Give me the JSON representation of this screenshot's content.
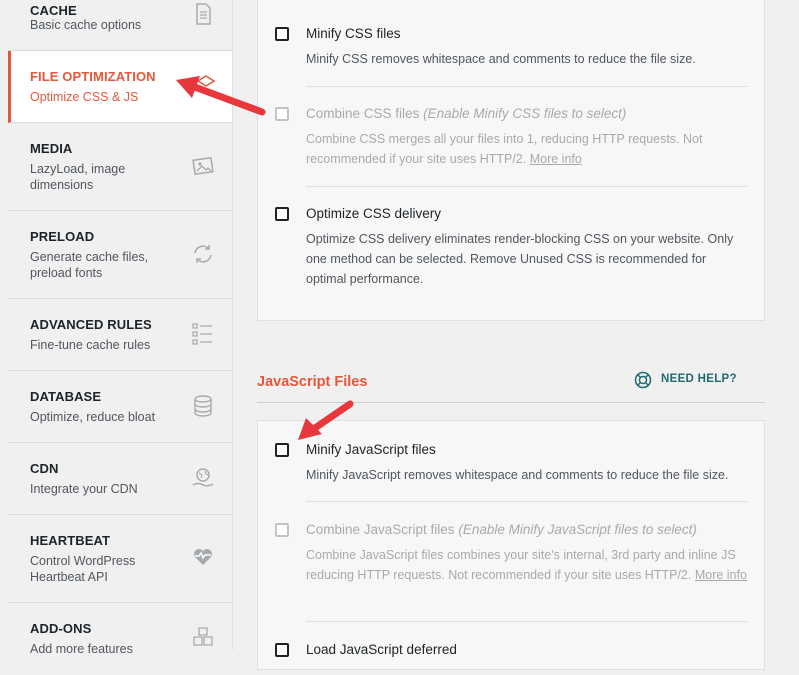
{
  "sidebar": {
    "items": [
      {
        "title": "CACHE",
        "desc": "Basic cache options",
        "icon": "document-icon"
      },
      {
        "title": "FILE OPTIMIZATION",
        "desc": "Optimize CSS & JS",
        "icon": "layers-icon",
        "active": true
      },
      {
        "title": "MEDIA",
        "desc": "LazyLoad, image dimensions",
        "icon": "image-icon"
      },
      {
        "title": "PRELOAD",
        "desc": "Generate cache files, preload fonts",
        "icon": "refresh-icon"
      },
      {
        "title": "ADVANCED RULES",
        "desc": "Fine-tune cache rules",
        "icon": "checklist-icon"
      },
      {
        "title": "DATABASE",
        "desc": "Optimize, reduce bloat",
        "icon": "database-icon"
      },
      {
        "title": "CDN",
        "desc": "Integrate your CDN",
        "icon": "globe-hand-icon"
      },
      {
        "title": "HEARTBEAT",
        "desc": "Control WordPress Heartbeat API",
        "icon": "heartbeat-icon"
      },
      {
        "title": "ADD-ONS",
        "desc": "Add more features",
        "icon": "cubes-icon"
      }
    ]
  },
  "css_options": {
    "minify": {
      "label": "Minify CSS files",
      "desc": "Minify CSS removes whitespace and comments to reduce the file size."
    },
    "combine": {
      "label": "Combine CSS files",
      "note": "(Enable Minify CSS files to select)",
      "desc": "Combine CSS merges all your files into 1, reducing HTTP requests. Not recommended if your site uses HTTP/2.",
      "link": "More info"
    },
    "delivery": {
      "label": "Optimize CSS delivery",
      "desc": "Optimize CSS delivery eliminates render-blocking CSS on your website. Only one method can be selected. Remove Unused CSS is recommended for optimal performance."
    }
  },
  "js_section": {
    "title": "JavaScript Files",
    "help": "NEED HELP?"
  },
  "js_options": {
    "minify": {
      "label": "Minify JavaScript files",
      "desc": "Minify JavaScript removes whitespace and comments to reduce the file size."
    },
    "combine": {
      "label": "Combine JavaScript files",
      "note": "(Enable Minify JavaScript files to select)",
      "desc": "Combine JavaScript files combines your site's internal, 3rd party and inline JS reducing HTTP requests. Not recommended if your site uses HTTP/2.",
      "link": "More info"
    },
    "defer": {
      "label": "Load JavaScript deferred"
    }
  },
  "colors": {
    "accent": "#e5573a",
    "help": "#1f6b6e",
    "arrow": "#e8383d"
  }
}
